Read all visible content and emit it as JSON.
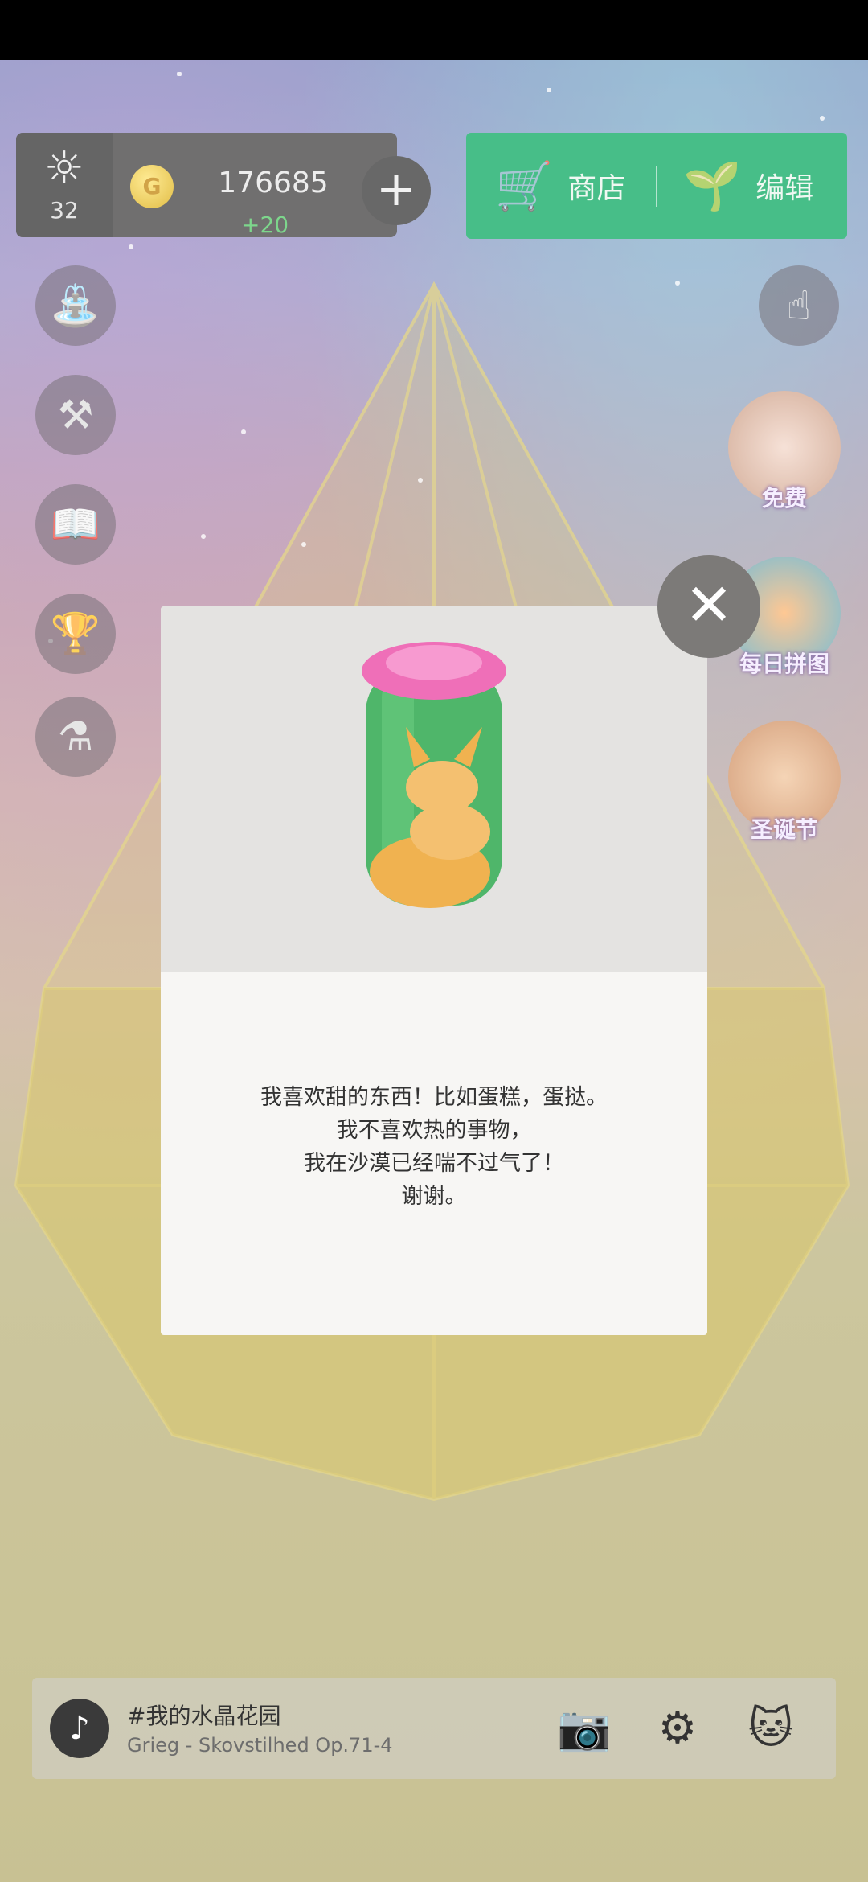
{
  "sun": {
    "icon": "sun-icon",
    "count": "32"
  },
  "coins": {
    "icon": "coin-icon",
    "symbol": "G",
    "value": "176685",
    "gain": "+20"
  },
  "shop": {
    "label": "商店",
    "icon": "cart-icon"
  },
  "edit": {
    "label": "编辑",
    "icon": "shovel-plant-icon"
  },
  "left_tools": [
    "watering-can-icon",
    "scythe-icon",
    "book-icon",
    "trophy-icon",
    "potion-flask-icon"
  ],
  "right_promos": [
    {
      "label": "免费",
      "icon": "cat-gift-icon"
    },
    {
      "label": "每日拼图",
      "icon": "red-panda-puzzle-icon"
    },
    {
      "label": "圣诞节",
      "icon": "reindeer-icon"
    }
  ],
  "dialog": {
    "lines": [
      "我喜欢甜的东西！比如蛋糕，蛋挞。",
      "我不喜欢热的事物，",
      "我在沙漠已经喘不过气了！",
      "谢谢。"
    ]
  },
  "music": {
    "title": "#我的水晶花园",
    "subtitle": "Grieg - Skovstilhed Op.71-4"
  },
  "colors": {
    "shop_green": "#00a65a",
    "gain_green": "#4cc760"
  }
}
